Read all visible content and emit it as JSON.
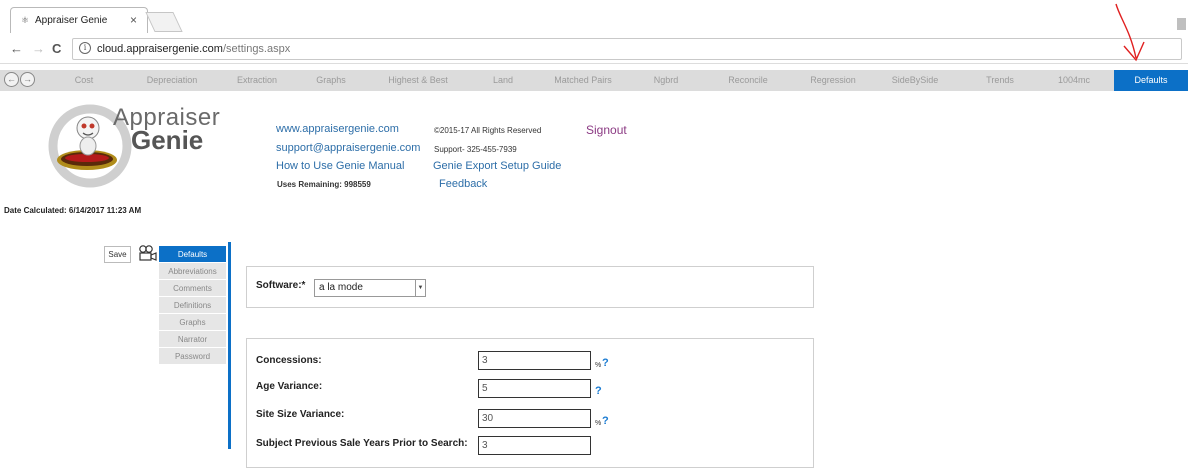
{
  "browser": {
    "tab_title": "Appraiser Genie",
    "tab_close": "×",
    "url_host": "cloud.appraisergenie.com",
    "url_path": "/settings.aspx",
    "back": "←",
    "forward": "→",
    "reload": "C"
  },
  "nav": {
    "back_icon": "←",
    "forward_icon": "→",
    "items": [
      "Cost",
      "Depreciation",
      "Extraction",
      "Graphs",
      "Highest & Best",
      "Land",
      "Matched Pairs",
      "Ngbrd",
      "Reconcile",
      "Regression",
      "SideBySide",
      "Trends",
      "1004mc",
      "Defaults"
    ],
    "active": "Defaults"
  },
  "logo": {
    "line1": "Appraiser",
    "line2": "Genie"
  },
  "header": {
    "website": "www.appraisergenie.com",
    "email": "support@appraisergenie.com",
    "manual": "How to Use Genie Manual",
    "uses_remaining": "Uses Remaining: 998559",
    "copyright": "©2015-17 All Rights Reserved",
    "support": "Support- 325-455-7939",
    "export_guide": "Genie Export Setup Guide",
    "feedback": "Feedback",
    "signout": "Signout"
  },
  "date_calculated": "Date Calculated: 6/14/2017 11:23 AM",
  "side": {
    "save": "Save",
    "items": [
      "Defaults",
      "Abbreviations",
      "Comments",
      "Definitions",
      "Graphs",
      "Narrator",
      "Password"
    ],
    "active": "Defaults"
  },
  "software": {
    "label": "Software:*",
    "value": "a la mode"
  },
  "fields": {
    "concessions": {
      "label": "Concessions:",
      "value": "3",
      "unit": "%",
      "help": "?"
    },
    "age_variance": {
      "label": "Age Variance:",
      "value": "5",
      "help": "?"
    },
    "site_size": {
      "label": "Site Size Variance:",
      "value": "30",
      "unit": "%",
      "help": "?"
    },
    "prev_sale": {
      "label": "Subject Previous Sale Years Prior to Search:",
      "value": "3"
    }
  },
  "annotation_color": "#e02020"
}
